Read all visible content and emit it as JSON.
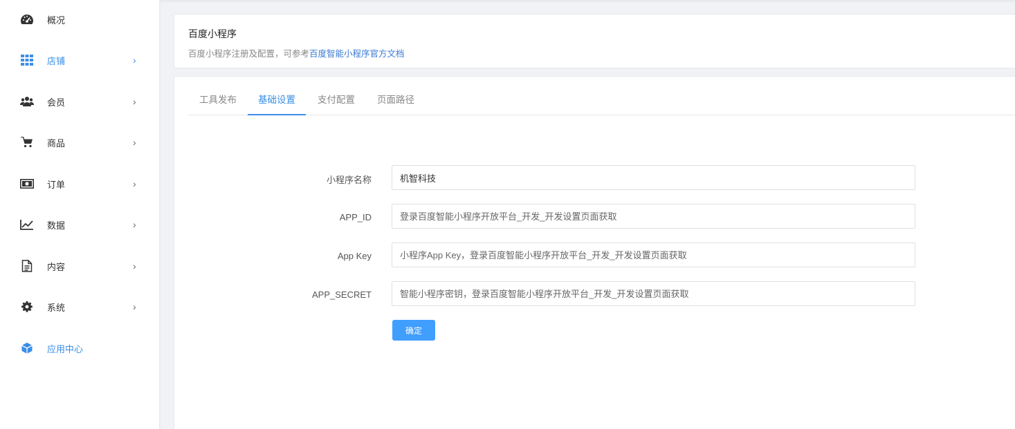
{
  "sidebar": {
    "items": [
      {
        "label": "概况",
        "icon": "dashboard-icon",
        "chevron": ""
      },
      {
        "label": "店铺",
        "icon": "grid-icon",
        "chevron": "›"
      },
      {
        "label": "会员",
        "icon": "users-icon",
        "chevron": "›"
      },
      {
        "label": "商品",
        "icon": "cart-icon",
        "chevron": "›"
      },
      {
        "label": "订单",
        "icon": "money-icon",
        "chevron": "›"
      },
      {
        "label": "数据",
        "icon": "line-chart-icon",
        "chevron": "›"
      },
      {
        "label": "内容",
        "icon": "document-icon",
        "chevron": "›"
      },
      {
        "label": "系统",
        "icon": "gear-icon",
        "chevron": "›"
      },
      {
        "label": "应用中心",
        "icon": "cube-icon",
        "chevron": ""
      }
    ],
    "active_index": 1,
    "accent_color": "#3a8ee6"
  },
  "header": {
    "title": "百度小程序",
    "desc_prefix": "百度小程序注册及配置，可参考",
    "desc_link": "百度智能小程序官方文档"
  },
  "tabs": [
    "工具发布",
    "基础设置",
    "支付配置",
    "页面路径"
  ],
  "active_tab": 1,
  "form": {
    "fields": [
      {
        "label": "小程序名称",
        "value": "机智科技",
        "placeholder": ""
      },
      {
        "label": "APP_ID",
        "value": "",
        "placeholder": "登录百度智能小程序开放平台_开发_开发设置页面获取"
      },
      {
        "label": "App Key",
        "value": "",
        "placeholder": "小程序App Key，登录百度智能小程序开放平台_开发_开发设置页面获取"
      },
      {
        "label": "APP_SECRET",
        "value": "",
        "placeholder": "智能小程序密钥，登录百度智能小程序开放平台_开发_开发设置页面获取"
      }
    ],
    "submit_label": "确定",
    "button_color": "#409eff"
  }
}
